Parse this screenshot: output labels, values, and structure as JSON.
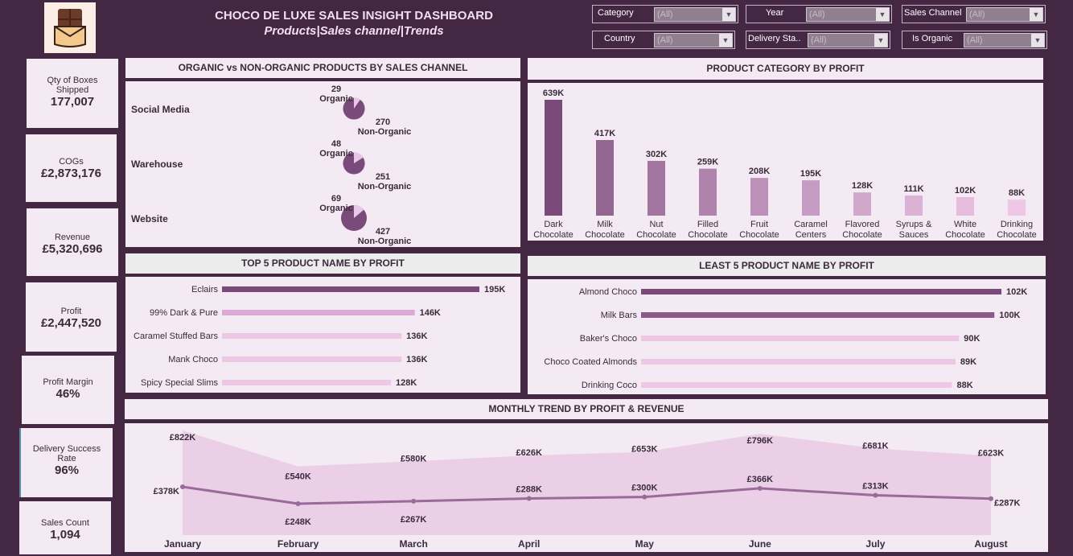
{
  "header": {
    "title": "CHOCO DE LUXE SALES INSIGHT DASHBOARD",
    "subtitle": "Products|Sales channel|Trends",
    "logo_icon": "chocolate-bar-icon"
  },
  "filters": {
    "category": {
      "label": "Category",
      "value": "(All)"
    },
    "year": {
      "label": "Year",
      "value": "(All)"
    },
    "sales_channel": {
      "label": "Sales Channel",
      "value": "(All)"
    },
    "country": {
      "label": "Country",
      "value": "(All)"
    },
    "delivery_status": {
      "label": "Delivery Sta..",
      "value": "(All)"
    },
    "is_organic": {
      "label": "Is Organic",
      "value": "(All)"
    }
  },
  "kpis": {
    "qty": {
      "label": "Qty of Boxes Shipped",
      "value": "177,007"
    },
    "cogs": {
      "label": "COGs",
      "value": "£2,873,176"
    },
    "revenue": {
      "label": "Revenue",
      "value": "£5,320,696"
    },
    "profit": {
      "label": "Profit",
      "value": "£2,447,520"
    },
    "margin": {
      "label": "Profit Margin",
      "value": "46%"
    },
    "delivery": {
      "label": "Delivery Success Rate",
      "value": "96%"
    },
    "sales_count": {
      "label": "Sales Count",
      "value": "1,094"
    }
  },
  "organic_panel": {
    "title": "ORGANIC vs NON-ORGANIC PRODUCTS BY SALES CHANNEL",
    "channels": [
      {
        "name": "Social Media",
        "organic_value": "29",
        "organic_label": "Organic",
        "non_value": "270",
        "non_label": "Non-Organic"
      },
      {
        "name": "Warehouse",
        "organic_value": "48",
        "organic_label": "Organic",
        "non_value": "251",
        "non_label": "Non-Organic"
      },
      {
        "name": "Website",
        "organic_value": "69",
        "organic_label": "Organic",
        "non_value": "427",
        "non_label": "Non-Organic"
      }
    ]
  },
  "category_panel": {
    "title": "PRODUCT CATEGORY BY PROFIT"
  },
  "top5_panel": {
    "title": "TOP 5 PRODUCT NAME BY PROFIT"
  },
  "least5_panel": {
    "title": "LEAST 5 PRODUCT NAME BY PROFIT"
  },
  "trend_panel": {
    "title": "MONTHLY TREND BY PROFIT & REVENUE"
  },
  "colors": {
    "background": "#432743",
    "panel": "#f3eaf3",
    "bar_dark": "#7a4a7a",
    "bar_light": "#eec6e6",
    "area_fill": "#ebcfe6",
    "profit_line": "#9a6a9a"
  },
  "chart_data": [
    {
      "type": "pie",
      "title": "ORGANIC vs NON-ORGANIC PRODUCTS BY SALES CHANNEL",
      "series": [
        {
          "name": "Social Media",
          "labels": [
            "Organic",
            "Non-Organic"
          ],
          "values": [
            29,
            270
          ]
        },
        {
          "name": "Warehouse",
          "labels": [
            "Organic",
            "Non-Organic"
          ],
          "values": [
            48,
            251
          ]
        },
        {
          "name": "Website",
          "labels": [
            "Organic",
            "Non-Organic"
          ],
          "values": [
            69,
            427
          ]
        }
      ]
    },
    {
      "type": "bar",
      "title": "PRODUCT CATEGORY BY PROFIT",
      "categories": [
        "Dark Chocolate",
        "Milk Chocolate",
        "Nut Chocolate",
        "Filled Chocolate",
        "Fruit Chocolate",
        "Caramel Centers",
        "Flavored Chocolate",
        "Syrups & Sauces",
        "White Chocolate",
        "Drinking Chocolate"
      ],
      "category_lines": [
        [
          "Dark",
          "Chocolate"
        ],
        [
          "Milk",
          "Chocolate"
        ],
        [
          "Nut",
          "Chocolate"
        ],
        [
          "Filled",
          "Chocolate"
        ],
        [
          "Fruit",
          "Chocolate"
        ],
        [
          "Caramel",
          "Centers"
        ],
        [
          "Flavored",
          "Chocolate"
        ],
        [
          "Syrups &",
          "Sauces"
        ],
        [
          "White",
          "Chocolate"
        ],
        [
          "Drinking",
          "Chocolate"
        ]
      ],
      "values": [
        639,
        417,
        302,
        259,
        208,
        195,
        128,
        111,
        102,
        88
      ],
      "value_labels": [
        "639K",
        "417K",
        "302K",
        "259K",
        "208K",
        "195K",
        "128K",
        "111K",
        "102K",
        "88K"
      ],
      "unit": "K"
    },
    {
      "type": "bar",
      "orientation": "horizontal",
      "title": "TOP 5 PRODUCT NAME BY PROFIT",
      "categories": [
        "Eclairs",
        "99% Dark & Pure",
        "Caramel Stuffed Bars",
        "Mank Choco",
        "Spicy Special Slims"
      ],
      "values": [
        195,
        146,
        136,
        136,
        128
      ],
      "value_labels": [
        "195K",
        "146K",
        "136K",
        "136K",
        "128K"
      ],
      "unit": "K"
    },
    {
      "type": "bar",
      "orientation": "horizontal",
      "title": "LEAST 5 PRODUCT NAME BY PROFIT",
      "categories": [
        "Almond Choco",
        "Milk Bars",
        "Baker's Choco",
        "Choco Coated Almonds",
        "Drinking Coco"
      ],
      "values": [
        102,
        100,
        90,
        89,
        88
      ],
      "value_labels": [
        "102K",
        "100K",
        "90K",
        "89K",
        "88K"
      ],
      "unit": "K"
    },
    {
      "type": "area",
      "title": "MONTHLY TREND BY PROFIT & REVENUE",
      "categories": [
        "January",
        "February",
        "March",
        "April",
        "May",
        "June",
        "July",
        "August"
      ],
      "series": [
        {
          "values": [
            822,
            540,
            580,
            626,
            653,
            796,
            681,
            623
          ],
          "labels": [
            "£822K",
            "£540K",
            "£580K",
            "£626K",
            "£653K",
            "£796K",
            "£681K",
            "£623K"
          ]
        },
        {
          "values": [
            378,
            248,
            267,
            288,
            300,
            366,
            313,
            287
          ],
          "labels": [
            "£378K",
            "£248K",
            "£267K",
            "£288K",
            "£300K",
            "£366K",
            "£313K",
            "£287K"
          ]
        }
      ]
    }
  ]
}
